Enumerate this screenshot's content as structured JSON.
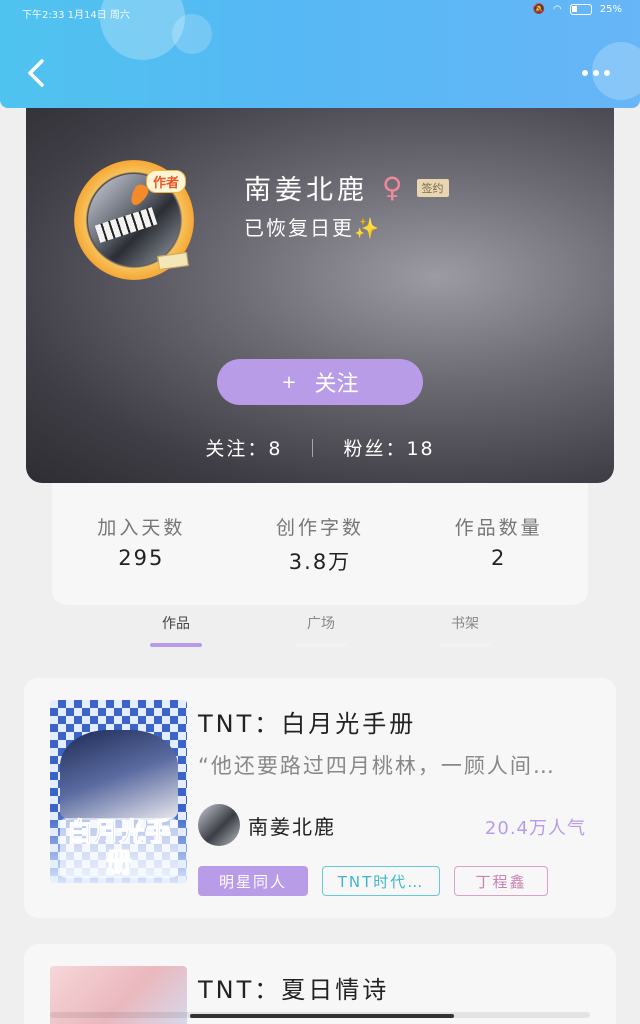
{
  "status_bar": {
    "time_date": "下午2:33 1月14日 周六",
    "battery": "25%"
  },
  "header": {
    "back_icon": "chevron-left-icon",
    "more_icon": "more-dots-icon"
  },
  "profile": {
    "author_badge": "作者",
    "name": "南姜北鹿",
    "gender_symbol": "♀",
    "signed_label": "签约",
    "bio": "已恢复日更✨",
    "follow_plus": "+",
    "follow_label": "关注",
    "following_text": "关注：8",
    "fans_text": "粉丝：18"
  },
  "stats": [
    {
      "label": "加入天数",
      "value": "295"
    },
    {
      "label": "创作字数",
      "value": "3.8万"
    },
    {
      "label": "作品数量",
      "value": "2"
    }
  ],
  "tabs": [
    {
      "label": "作品",
      "active": true
    },
    {
      "label": "广场",
      "active": false
    },
    {
      "label": "书架",
      "active": false
    }
  ],
  "works": [
    {
      "title": "TNT：白月光手册",
      "cover_text": "白月光手册",
      "description": "“他还要路过四月桃林，一顾人间…",
      "author": "南姜北鹿",
      "readers": "20.4万人气",
      "tags": [
        "明星同人",
        "TNT时代…",
        "丁程鑫"
      ]
    },
    {
      "title": "TNT：夏日情诗"
    }
  ],
  "colors": {
    "accent": "#b89ce8",
    "header_blue": "#56b8f4"
  }
}
